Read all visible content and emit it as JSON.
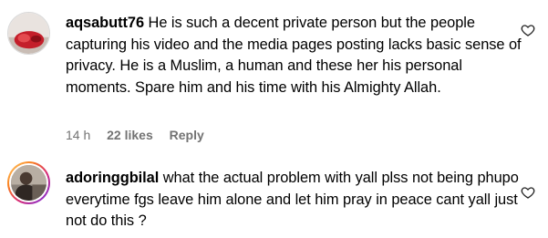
{
  "comments": [
    {
      "username": "aqsabutt76",
      "text": "He is such a decent private person but the people capturing his video and the media pages posting lacks basic sense of privacy. He is a Muslim, a human and these her his personal moments. Spare him and his time with his Almighty Allah.",
      "time": "14 h",
      "likes": "22 likes",
      "reply": "Reply",
      "avatar_icon": "avatar-photo",
      "like_icon": "heart-outline-icon"
    },
    {
      "username": "adoringgbilal",
      "text": "what the actual problem with yall plss not being phupo everytime fgs leave him alone and let him pray in peace cant yall just not do this ?",
      "avatar_icon": "avatar-photo",
      "like_icon": "heart-outline-icon"
    }
  ],
  "colors": {
    "meta_text": "#737373",
    "story_ring_start": "#feda75",
    "story_ring_end": "#4f5bd5"
  }
}
